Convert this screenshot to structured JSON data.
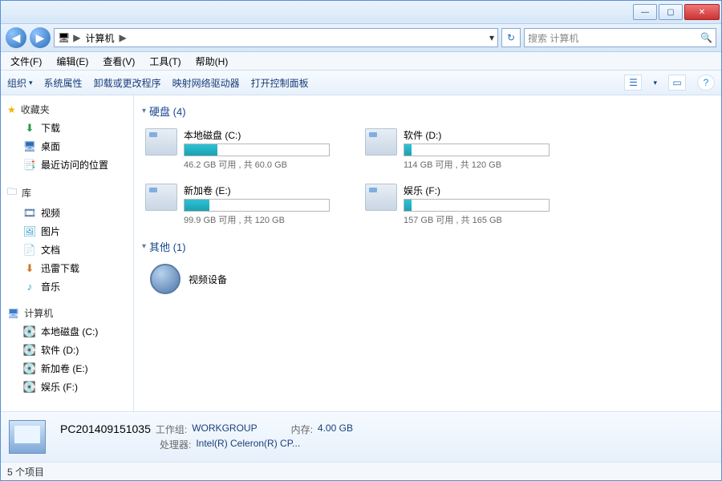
{
  "titlebar": {
    "min": "—",
    "max": "▢",
    "close": "✕"
  },
  "nav": {
    "back": "◀",
    "forward": "▶",
    "crumb_icon": "🖥",
    "crumb1": "计算机",
    "crumb_sep": "▶",
    "drop": "▾",
    "refresh": "↻",
    "search_placeholder": "搜索 计算机",
    "search_icon": "🔍"
  },
  "menu": {
    "file": "文件(F)",
    "edit": "编辑(E)",
    "view": "查看(V)",
    "tools": "工具(T)",
    "help": "帮助(H)"
  },
  "toolbar": {
    "organize": "组织",
    "drop": "▾",
    "sysprops": "系统属性",
    "uninstall": "卸载或更改程序",
    "mapdrive": "映射网络驱动器",
    "ctrlpanel": "打开控制面板",
    "view_icon": "☰",
    "pane_icon": "▭",
    "help_icon": "?"
  },
  "sidebar": {
    "fav": {
      "label": "收藏夹",
      "items": [
        {
          "icon": "⬇",
          "label": "下载",
          "color": "#2a9c46"
        },
        {
          "icon": "🖥",
          "label": "桌面",
          "color": "#2a6db8"
        },
        {
          "icon": "📑",
          "label": "最近访问的位置",
          "color": "#7a8aa0"
        }
      ]
    },
    "lib": {
      "label": "库",
      "items": [
        {
          "icon": "🎞",
          "label": "视频",
          "color": "#3a6a9a"
        },
        {
          "icon": "🖼",
          "label": "图片",
          "color": "#3aa0c8"
        },
        {
          "icon": "📄",
          "label": "文档",
          "color": "#7a8aa0"
        },
        {
          "icon": "⬇",
          "label": "迅雷下载",
          "color": "#d07a2a"
        },
        {
          "icon": "♪",
          "label": "音乐",
          "color": "#2a9cc8"
        }
      ]
    },
    "comp": {
      "label": "计算机",
      "items": [
        {
          "icon": "💽",
          "label": "本地磁盘 (C:)"
        },
        {
          "icon": "💽",
          "label": "软件 (D:)"
        },
        {
          "icon": "💽",
          "label": "新加卷 (E:)"
        },
        {
          "icon": "💽",
          "label": "娱乐 (F:)"
        }
      ]
    }
  },
  "content": {
    "hd_hdr": "硬盘 (4)",
    "drives": [
      {
        "name": "本地磁盘 (C:)",
        "free": "46.2 GB 可用 , 共 60.0 GB",
        "pct": 23
      },
      {
        "name": "软件 (D:)",
        "free": "114 GB 可用 , 共 120 GB",
        "pct": 5
      },
      {
        "name": "新加卷 (E:)",
        "free": "99.9 GB 可用 , 共 120 GB",
        "pct": 17
      },
      {
        "name": "娱乐 (F:)",
        "free": "157 GB 可用 , 共 165 GB",
        "pct": 5
      }
    ],
    "other_hdr": "其他 (1)",
    "other": [
      {
        "label": "视频设备"
      }
    ]
  },
  "details": {
    "name": "PC201409151035",
    "wg_lab": "工作组:",
    "wg": "WORKGROUP",
    "mem_lab": "内存:",
    "mem": "4.00 GB",
    "cpu_lab": "处理器:",
    "cpu": "Intel(R) Celeron(R) CP..."
  },
  "status": {
    "text": "5 个项目"
  }
}
